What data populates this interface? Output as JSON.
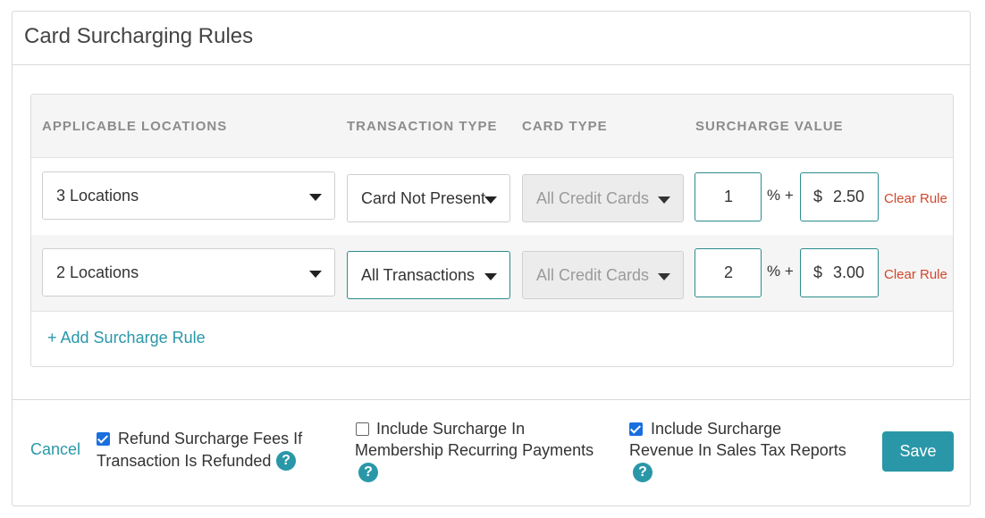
{
  "page": {
    "title": "Card Surcharging Rules"
  },
  "columns": {
    "locations": "APPLICABLE LOCATIONS",
    "transaction_type": "TRANSACTION TYPE",
    "card_type": "CARD TYPE",
    "surcharge_value": "SURCHARGE VALUE"
  },
  "rules": [
    {
      "locations": "3 Locations",
      "transaction_type": "Card Not Present",
      "card_type": "All Credit Cards",
      "percent": "1",
      "percent_sign": "% +",
      "currency": "$",
      "amount": "2.50",
      "clear_label": "Clear Rule"
    },
    {
      "locations": "2 Locations",
      "transaction_type": "All Transactions",
      "card_type": "All Credit Cards",
      "percent": "2",
      "percent_sign": "% +",
      "currency": "$",
      "amount": "3.00",
      "clear_label": "Clear Rule"
    }
  ],
  "add_rule_label": "+ Add Surcharge Rule",
  "footer": {
    "cancel_label": "Cancel",
    "options": [
      {
        "label_line1": "Refund Surcharge Fees If",
        "label_line2": "Transaction Is Refunded",
        "checked": true
      },
      {
        "label_line1": "Include Surcharge In",
        "label_line2": "Membership Recurring Payments",
        "checked": false
      },
      {
        "label_line1": "Include Surcharge",
        "label_line2": "Revenue In Sales Tax Reports",
        "checked": true
      }
    ],
    "help_glyph": "?",
    "save_label": "Save"
  },
  "colors": {
    "accent": "#2a97a8",
    "danger": "#d1472b",
    "checkbox": "#1a6fe0",
    "input_border": "#2c8c8c"
  }
}
